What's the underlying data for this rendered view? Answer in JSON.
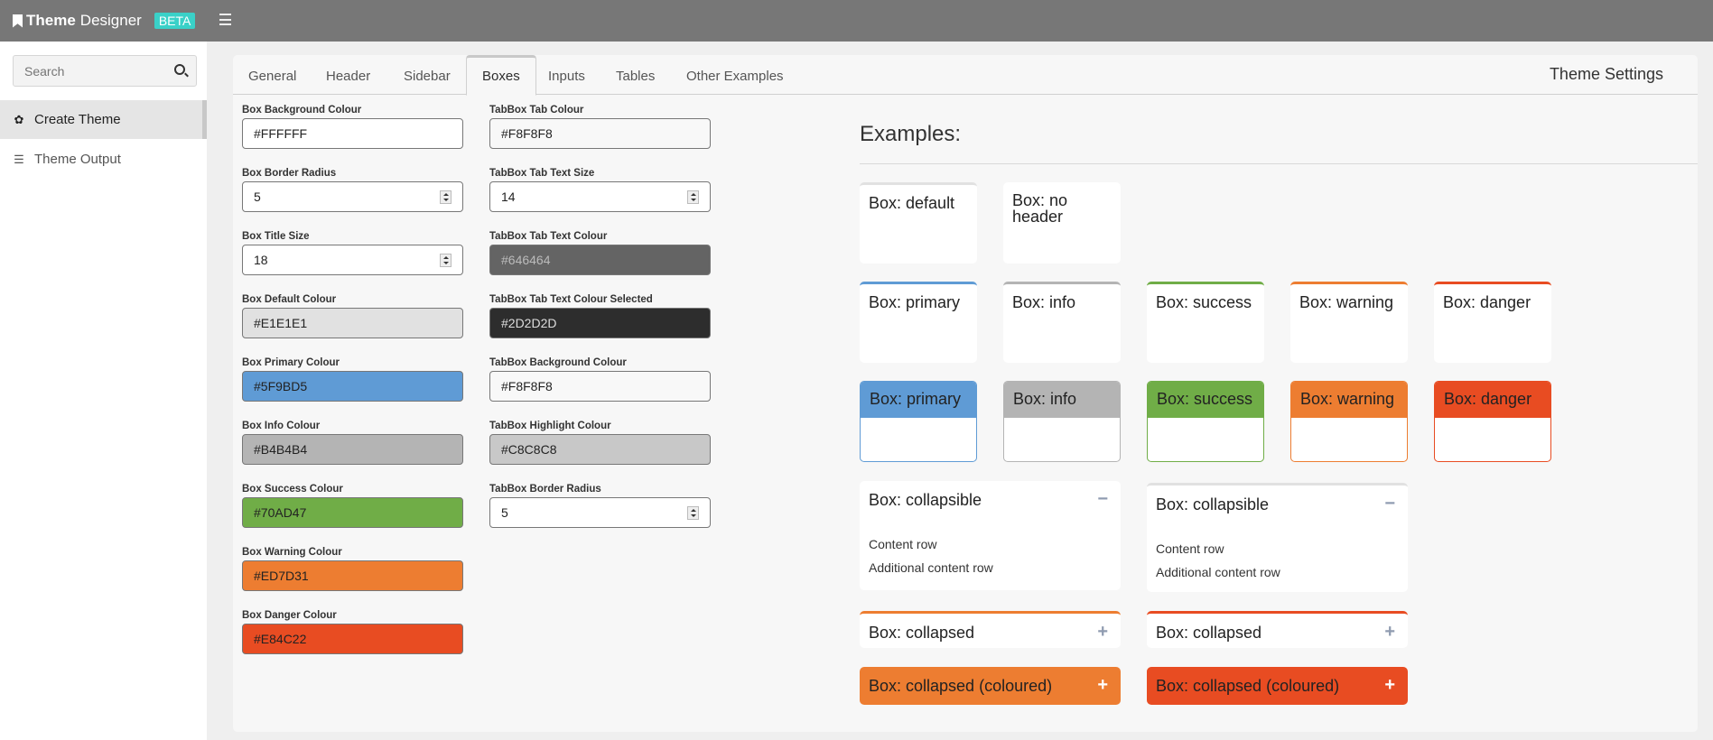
{
  "app": {
    "title_bold": "Theme",
    "title_rest": "Designer",
    "badge": "BETA",
    "menu_icon": "hamburger-icon",
    "bookmark_icon": "bookmark-icon"
  },
  "sidebar": {
    "search_placeholder": "Search",
    "search_icon": "search-icon",
    "items": [
      {
        "label": "Create Theme",
        "icon": "gear-icon",
        "active": true
      },
      {
        "label": "Theme Output",
        "icon": "list-icon",
        "active": false
      }
    ]
  },
  "tabs": [
    {
      "label": "General"
    },
    {
      "label": "Header"
    },
    {
      "label": "Sidebar"
    },
    {
      "label": "Boxes",
      "selected": true
    },
    {
      "label": "Inputs"
    },
    {
      "label": "Tables"
    },
    {
      "label": "Other Examples"
    }
  ],
  "panel_title": "Theme Settings",
  "form": {
    "col1": [
      {
        "label": "Box Background Colour",
        "value": "#FFFFFF",
        "type": "color",
        "bg": "#FFFFFF",
        "fg": "#222222"
      },
      {
        "label": "Box Border Radius",
        "value": "5",
        "type": "number"
      },
      {
        "label": "Box Title Size",
        "value": "18",
        "type": "number"
      },
      {
        "label": "Box Default Colour",
        "value": "#E1E1E1",
        "type": "color",
        "bg": "#E1E1E1",
        "fg": "#222222"
      },
      {
        "label": "Box Primary Colour",
        "value": "#5F9BD5",
        "type": "color",
        "bg": "#5F9BD5",
        "fg": "#222222"
      },
      {
        "label": "Box Info Colour",
        "value": "#B4B4B4",
        "type": "color",
        "bg": "#B4B4B4",
        "fg": "#222222"
      },
      {
        "label": "Box Success Colour",
        "value": "#70AD47",
        "type": "color",
        "bg": "#70AD47",
        "fg": "#222222"
      },
      {
        "label": "Box Warning Colour",
        "value": "#ED7D31",
        "type": "color",
        "bg": "#ED7D31",
        "fg": "#222222"
      },
      {
        "label": "Box Danger Colour",
        "value": "#E84C22",
        "type": "color",
        "bg": "#E84C22",
        "fg": "#222222"
      }
    ],
    "col2": [
      {
        "label": "TabBox Tab Colour",
        "value": "#F8F8F8",
        "type": "color",
        "bg": "#F8F8F8",
        "fg": "#222222"
      },
      {
        "label": "TabBox Tab Text Size",
        "value": "14",
        "type": "number"
      },
      {
        "label": "TabBox Tab Text Colour",
        "value": "#646464",
        "type": "color",
        "bg": "#646464",
        "fg": "#BBBBBB"
      },
      {
        "label": "TabBox Tab Text Colour Selected",
        "value": "#2D2D2D",
        "type": "color",
        "bg": "#2D2D2D",
        "fg": "#DDDDDD"
      },
      {
        "label": "TabBox Background Colour",
        "value": "#F8F8F8",
        "type": "color",
        "bg": "#F8F8F8",
        "fg": "#222222"
      },
      {
        "label": "TabBox Highlight Colour",
        "value": "#C8C8C8",
        "type": "color",
        "bg": "#C8C8C8",
        "fg": "#222222"
      },
      {
        "label": "TabBox Border Radius",
        "value": "5",
        "type": "number"
      }
    ]
  },
  "examples": {
    "title": "Examples:",
    "plain": [
      {
        "label": "Box: default",
        "top": "#E1E1E1"
      },
      {
        "label": "Box: no header"
      }
    ],
    "statuses": [
      {
        "label": "Box: primary",
        "color": "#5F9BD5"
      },
      {
        "label": "Box: info",
        "color": "#B4B4B4"
      },
      {
        "label": "Box: success",
        "color": "#70AD47"
      },
      {
        "label": "Box: warning",
        "color": "#ED7D31"
      },
      {
        "label": "Box: danger",
        "color": "#E84C22"
      }
    ],
    "collapsible": [
      {
        "label": "Box: collapsible",
        "toggle": "−",
        "rows": [
          "Content row",
          "Additional content row"
        ]
      },
      {
        "label": "Box: collapsible",
        "toggle": "−",
        "rows": [
          "Content row",
          "Additional content row"
        ],
        "top": "#E1E1E1"
      }
    ],
    "collapsed": [
      {
        "label": "Box: collapsed",
        "toggle": "+",
        "top": "#ED7D31"
      },
      {
        "label": "Box: collapsed",
        "toggle": "+",
        "top": "#E84C22"
      }
    ],
    "collapsed_coloured": [
      {
        "label": "Box: collapsed (coloured)",
        "toggle": "+",
        "bg": "#ED7D31"
      },
      {
        "label": "Box: collapsed (coloured)",
        "toggle": "+",
        "bg": "#E84C22"
      }
    ]
  }
}
